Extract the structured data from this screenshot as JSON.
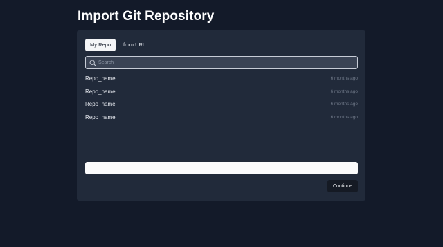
{
  "page": {
    "title": "Import Git Repository"
  },
  "tabs": [
    {
      "label": "My Repo",
      "active": true
    },
    {
      "label": "from URL",
      "active": false
    }
  ],
  "search": {
    "placeholder": "Search",
    "value": "",
    "icon": "search-icon"
  },
  "repos": [
    {
      "name": "Repo_name",
      "updated": "6 months ago"
    },
    {
      "name": "Repo_name",
      "updated": "6 months ago"
    },
    {
      "name": "Repo_name",
      "updated": "6 months ago"
    },
    {
      "name": "Repo_name",
      "updated": "6 months ago"
    }
  ],
  "url_field": {
    "value": ""
  },
  "actions": {
    "continue_label": "Continue"
  },
  "colors": {
    "background": "#131a29",
    "panel": "#212a3a",
    "search_bg": "#3a4354",
    "active_tab": "#f4f5f7",
    "button": "#151a24"
  }
}
